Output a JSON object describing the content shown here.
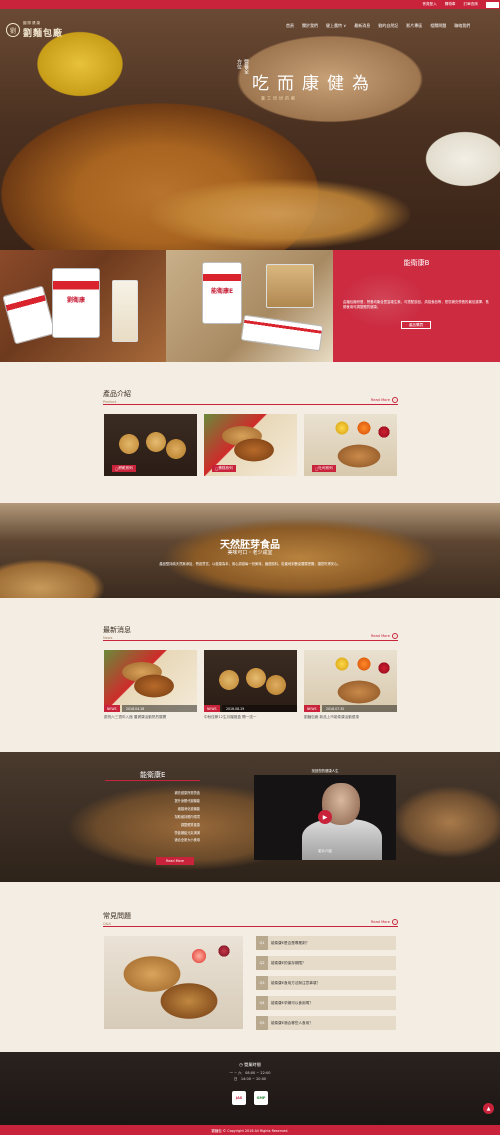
{
  "topbar": {
    "member_login": "會員登入",
    "cart": "購物車",
    "order_query": "訂單查詢",
    "line": "LINE"
  },
  "logo": {
    "sub": "國際健康",
    "main": "劉麵包廠",
    "seal": "劉"
  },
  "nav": [
    "首頁",
    "關於我們",
    "健上農特 ∨",
    "最新消息",
    "劉的自然記",
    "影片專區",
    "相關問題",
    "聯絡我們"
  ],
  "hero": {
    "slogan_big": "為健康而吃",
    "slogan_small": "營養全方位",
    "slogan_small2": "劉的烘焙工藝"
  },
  "promo": {
    "jar1_label": "劉衛康",
    "jar2_label": "能衛康E",
    "card_title": "能衛康B",
    "card_desc": "由麵包廠研發，營養均衡含豐富維生素，可搭配飲品、烘焙食品等，是您補充營養的最佳選擇，長期食用可調整體質健康。",
    "card_button": "產品購買"
  },
  "products": {
    "title": "產品介紹",
    "subtitle": "Product",
    "more": "Read More",
    "items": [
      {
        "label": "餅乾系列",
        "icon": "cookie-icon"
      },
      {
        "label": "蛋糕系列",
        "icon": "cake-icon"
      },
      {
        "label": "吐司系列",
        "icon": "bread-icon"
      }
    ]
  },
  "banner": {
    "title": "天然胚芽食品",
    "subtitle": "美味可口・老少咸宜",
    "desc": "產品堅持純天然無添加，營養豐富，以健康為本，用心烘焙每一份美味，嚴選原料，從產地到餐桌層層把關，讓您吃得安心。"
  },
  "news": {
    "title": "最新消息",
    "subtitle": "News",
    "more": "Read More",
    "items": [
      {
        "tag": "NEWS",
        "date": "2016.04.28",
        "text": "慶祝六三週年入館 農健康活動熱烈展開"
      },
      {
        "tag": "NEWS",
        "date": "2016.08.29",
        "text": "中秋佳節12生月檔禮盒 開一送一"
      },
      {
        "tag": "NEWS",
        "date": "2016.07.30",
        "text": "劉麵包廠 新品上市能衛康活動優惠"
      }
    ]
  },
  "video_section": {
    "title": "能衛康E",
    "bullets": [
      "補充健康所需營養",
      "提升身體代謝機能",
      "維護消化道機能",
      "幫助維持體內環境",
      "調整體質健康",
      "營養補給元氣滿滿",
      "適合全家大小食用"
    ],
    "button": "Read More",
    "video_title": "找回您的健康人生",
    "video_caption": "影片介紹"
  },
  "faq": {
    "title": "常見問題",
    "subtitle": "Q&A",
    "more": "Read More",
    "items": [
      {
        "q": "Q1",
        "text": "能衛康E是否是專業劑？"
      },
      {
        "q": "Q2",
        "text": "能衛康E的保存期限？"
      },
      {
        "q": "Q3",
        "text": "能衛康E食用方法與注意事項？"
      },
      {
        "q": "Q4",
        "text": "能衛康E孕婦可以食用嗎？"
      },
      {
        "q": "Q5",
        "text": "能衛康E適合哪些人食用？"
      }
    ]
  },
  "footer": {
    "hours_title": "營業時間",
    "hours": [
      "一 ~ 六　08:00 ~ 22:00",
      "日　14:00 ~ 20:00"
    ],
    "badge1": "JAS",
    "badge2": "GMP",
    "copyright": "劉麵包 © Copyright 2016 All Rights Reserved."
  },
  "colors": {
    "brand": "#c8233a",
    "paper": "#f3ede3"
  }
}
